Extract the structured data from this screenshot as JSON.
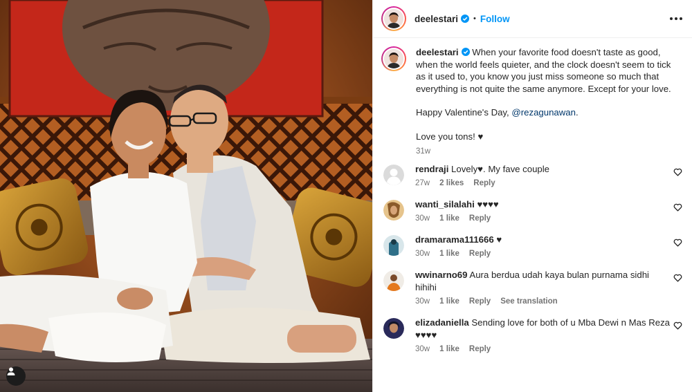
{
  "post": {
    "author": "deelestari",
    "follow_label": "Follow",
    "separator": "•"
  },
  "caption": {
    "username": "deelestari",
    "text": " When your favorite food doesn't taste as good, when the world feels quieter, and the clock doesn't seem to tick as it used to, you know you just miss someone so much that everything is not quite the same anymore. Except for your love.",
    "valentine_prefix": "Happy Valentine's Day, ",
    "mention": "@rezagunawan",
    "valentine_suffix": ".",
    "closing": "Love you tons! ♥",
    "time": "31w"
  },
  "comments": [
    {
      "username": "rendraji",
      "text": "Lovely♥. My fave couple",
      "time": "27w",
      "likes": "2 likes",
      "reply": "Reply",
      "avatar": "default-avatar-icon"
    },
    {
      "username": "wanti_silalahi",
      "text": "♥♥♥♥",
      "time": "30w",
      "likes": "1 like",
      "reply": "Reply",
      "avatar": "photo-avatar"
    },
    {
      "username": "dramarama111666",
      "text": "♥",
      "time": "30w",
      "likes": "1 like",
      "reply": "Reply",
      "avatar": "photo-avatar"
    },
    {
      "username": "wwinarno69",
      "text": "Aura berdua udah kaya bulan purnama sidhi hihihi",
      "time": "30w",
      "likes": "1 like",
      "reply": "Reply",
      "translate": "See translation",
      "avatar": "photo-avatar"
    },
    {
      "username": "elizadaniella",
      "text": "Sending love for both of u Mba Dewi n Mas Reza ♥♥♥♥",
      "time": "30w",
      "likes": "1 like",
      "reply": "Reply",
      "avatar": "photo-avatar"
    }
  ],
  "colors": {
    "accent": "#0095f6",
    "verified": "#0095f6",
    "muted": "#737373",
    "text": "#262626"
  }
}
